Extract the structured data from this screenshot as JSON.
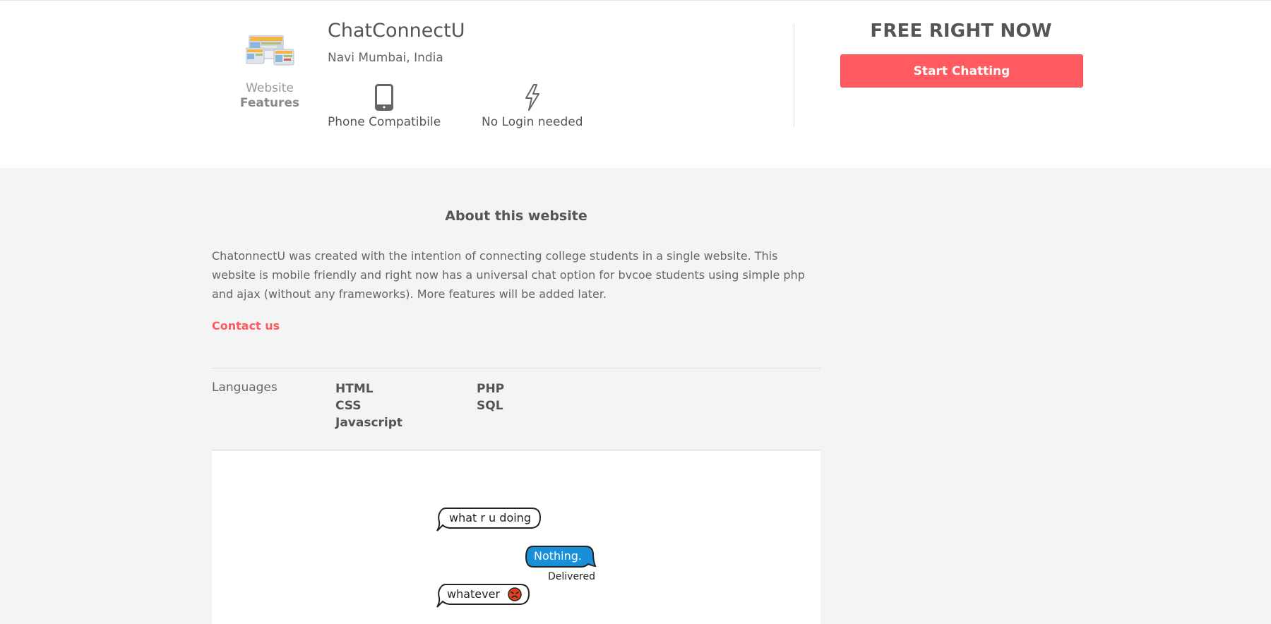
{
  "header": {
    "app_name": "ChatConnectU",
    "location": "Navi Mumbai, India",
    "kind_label": "Website",
    "kind_sub": "Features",
    "icon": "website-screens-icon",
    "features": [
      {
        "label": "Phone Compatibile",
        "icon": "phone-icon"
      },
      {
        "label": "No Login needed",
        "icon": "lightning-bolt-icon"
      }
    ]
  },
  "pricing": {
    "label": "FREE RIGHT NOW",
    "cta_label": "Start Chatting",
    "accent_color": "#ff5a60"
  },
  "about": {
    "title": "About this website",
    "body": "ChatonnectU was created with the intention of connecting college students in a single website. This website is mobile friendly and right now has a universal chat option for bvcoe students using simple php and ajax (without any frameworks). More features will be added later.",
    "contact_label": "Contact us"
  },
  "languages": {
    "label": "Languages",
    "column_1": [
      "HTML",
      "CSS",
      "Javascript"
    ],
    "column_2": [
      "PHP",
      "SQL"
    ]
  },
  "preview": {
    "messages": [
      {
        "text": "what r u doing",
        "side": "left"
      },
      {
        "text": "Nothing.",
        "side": "right",
        "status": "Delivered",
        "color": "#1a8fd9"
      },
      {
        "text": "whatever",
        "side": "left",
        "emoji": "angry-face-icon"
      }
    ]
  }
}
